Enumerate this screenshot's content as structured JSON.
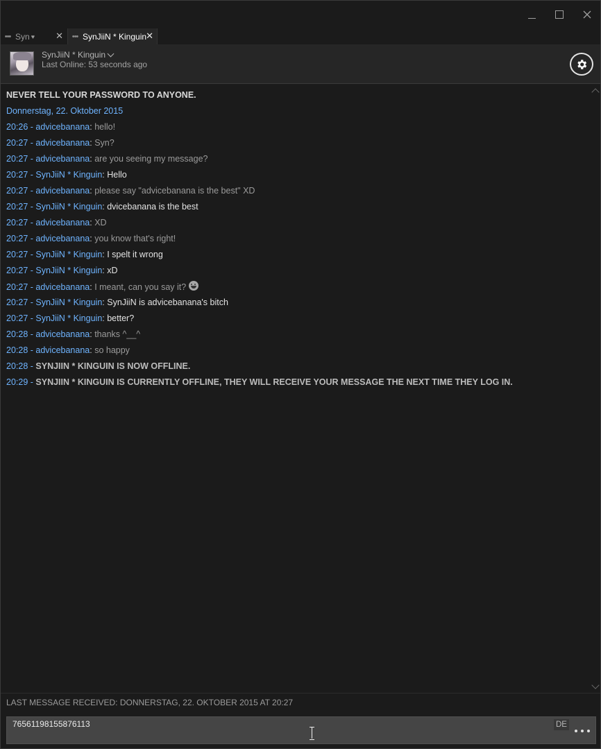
{
  "tabs": [
    {
      "label": "Syn",
      "active": false,
      "close": "✕"
    },
    {
      "label": "SynJiiN * Kinguin",
      "active": true,
      "close": "✕"
    }
  ],
  "friend": {
    "name": "SynJiiN * Kinguin",
    "status": "Last Online: 53 seconds ago"
  },
  "chat": {
    "warning": "NEVER TELL YOUR PASSWORD TO ANYONE.",
    "date": "Donnerstag, 22. Oktober 2015",
    "messages": [
      {
        "time": "20:26",
        "sender": "advicebanana",
        "text": "hello!",
        "self": true
      },
      {
        "time": "20:27",
        "sender": "advicebanana",
        "text": "Syn?",
        "self": true
      },
      {
        "time": "20:27",
        "sender": "advicebanana",
        "text": "are you seeing my message?",
        "self": true
      },
      {
        "time": "20:27",
        "sender": "SynJiiN * Kinguin",
        "text": "Hello",
        "self": false
      },
      {
        "time": "20:27",
        "sender": "advicebanana",
        "text": "please say \"advicebanana is the best\" XD",
        "self": true
      },
      {
        "time": "20:27",
        "sender": "SynJiiN * Kinguin",
        "text": "dvicebanana is the best",
        "self": false
      },
      {
        "time": "20:27",
        "sender": "advicebanana",
        "text": "XD",
        "self": true
      },
      {
        "time": "20:27",
        "sender": "advicebanana",
        "text": "you know that's right!",
        "self": true
      },
      {
        "time": "20:27",
        "sender": "SynJiiN * Kinguin",
        "text": "I spelt it wrong",
        "self": false
      },
      {
        "time": "20:27",
        "sender": "SynJiiN * Kinguin",
        "text": "xD",
        "self": false
      },
      {
        "time": "20:27",
        "sender": "advicebanana",
        "text": "I meant, can you say it?",
        "self": true,
        "emoji": "grin-emoticon"
      },
      {
        "time": "20:27",
        "sender": "SynJiiN * Kinguin",
        "text": "SynJiiN is advicebanana's bitch",
        "self": false
      },
      {
        "time": "20:27",
        "sender": "SynJiiN * Kinguin",
        "text": "better?",
        "self": false
      },
      {
        "time": "20:28",
        "sender": "advicebanana",
        "text": "thanks ^__^",
        "self": true
      },
      {
        "time": "20:28",
        "sender": "advicebanana",
        "text": "so happy",
        "self": true
      }
    ],
    "system": [
      {
        "time": "20:28",
        "text": "SYNJIIN * KINGUIN IS NOW OFFLINE."
      },
      {
        "time": "20:29",
        "text": "SYNJIIN * KINGUIN IS CURRENTLY OFFLINE, THEY WILL RECEIVE YOUR MESSAGE THE NEXT TIME THEY LOG IN."
      }
    ]
  },
  "footer": {
    "last_received": "LAST MESSAGE RECEIVED: DONNERSTAG, 22. OKTOBER 2015 AT 20:27",
    "input_value": "76561198155876113",
    "language": "DE"
  },
  "colors": {
    "accent": "#6fb4ff",
    "background": "#1b1b1b",
    "header": "#262626",
    "input": "#454545"
  }
}
